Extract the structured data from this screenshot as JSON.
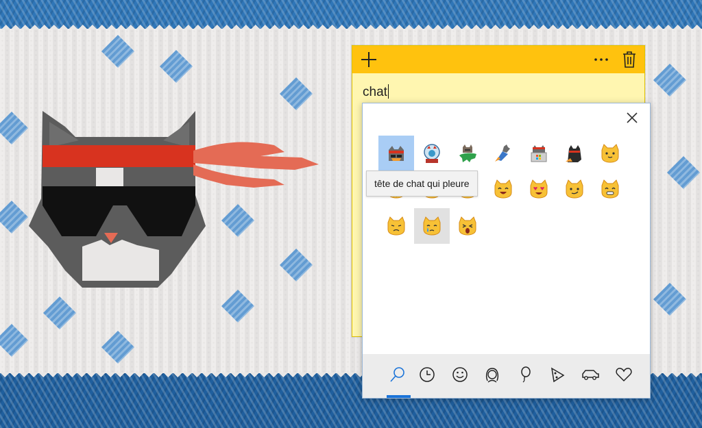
{
  "sticky_note": {
    "text": "chat",
    "toolbar": {
      "add_icon": "plus-icon",
      "more_icon": "ellipsis-icon",
      "delete_icon": "trash-icon"
    },
    "colors": {
      "toolbar": "#ffc20e",
      "body": "#fff6b0"
    }
  },
  "emoji_panel": {
    "close_icon": "close-icon",
    "tooltip": "tête de chat qui pleure",
    "selected_emoji": "ninja-cat",
    "hovered_emoji": "crying-cat-face",
    "emojis": [
      {
        "name": "ninja-cat-icon"
      },
      {
        "name": "astro-cat-icon"
      },
      {
        "name": "dino-cat-icon"
      },
      {
        "name": "hacker-cat-icon"
      },
      {
        "name": "hipster-cat-icon"
      },
      {
        "name": "stack-cat-icon"
      },
      {
        "name": "cat-face-icon"
      },
      {
        "name": "cat-face-partial-icon"
      },
      {
        "name": "cat-face-partial-2-icon"
      },
      {
        "name": "cat-face-partial-3-icon"
      },
      {
        "name": "smiling-cat-icon"
      },
      {
        "name": "heart-eyes-cat-icon"
      },
      {
        "name": "wry-smile-cat-icon"
      },
      {
        "name": "grinning-cat-icon"
      },
      {
        "name": "pouting-cat-icon"
      },
      {
        "name": "crying-cat-icon"
      },
      {
        "name": "weary-cat-icon"
      }
    ],
    "categories": [
      {
        "name": "search-icon",
        "active": true
      },
      {
        "name": "recent-clock-icon",
        "active": false
      },
      {
        "name": "smiley-icon",
        "active": false
      },
      {
        "name": "people-icon",
        "active": false
      },
      {
        "name": "balloon-icon",
        "active": false
      },
      {
        "name": "pizza-icon",
        "active": false
      },
      {
        "name": "car-icon",
        "active": false
      },
      {
        "name": "heart-icon",
        "active": false
      }
    ],
    "accent_color": "#1a73d8"
  }
}
